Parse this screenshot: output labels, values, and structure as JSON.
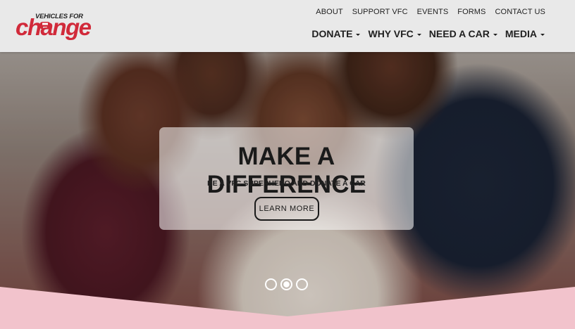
{
  "brand": {
    "logo_top": "VEHICLES FOR",
    "logo_main": "change",
    "color": "#d12a3a"
  },
  "top_nav": [
    "ABOUT",
    "SUPPORT VFC",
    "EVENTS",
    "FORMS",
    "CONTACT US"
  ],
  "main_nav": [
    "DONATE",
    "WHY VFC",
    "NEED A CAR",
    "MEDIA"
  ],
  "hero": {
    "title": "MAKE A DIFFERENCE",
    "subtitle": "BE A VFC SUPERHERO AND DONATE A CAR",
    "button": "LEARN MORE"
  },
  "carousel": {
    "slides": 3,
    "active": 2
  },
  "colors": {
    "header_bg": "#e9e9e9",
    "pink_band": "#f2c3cc"
  }
}
